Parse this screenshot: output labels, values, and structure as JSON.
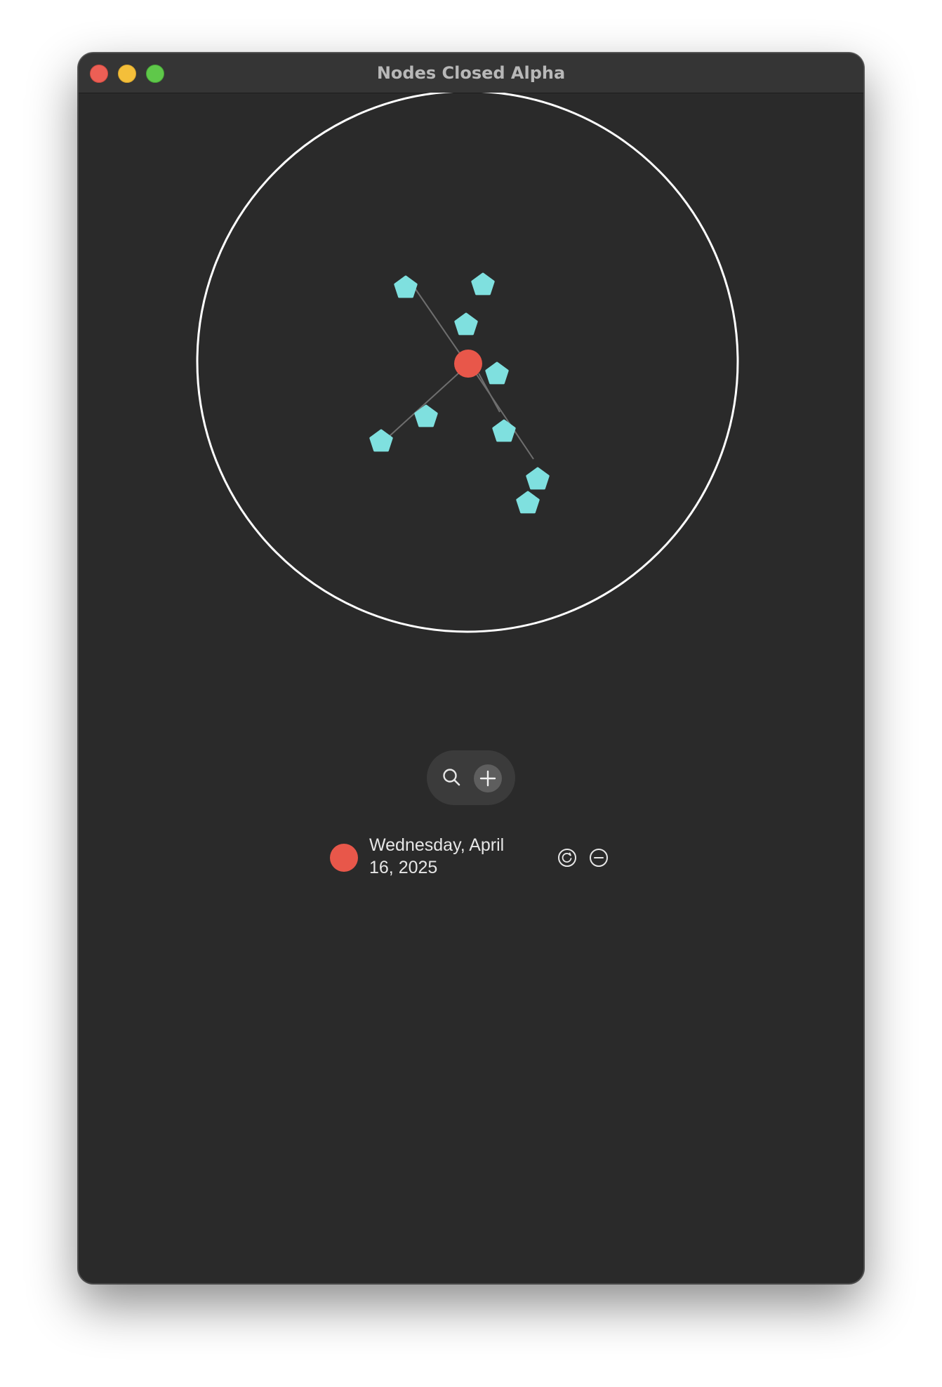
{
  "window": {
    "title": "Nodes Closed Alpha"
  },
  "graph": {
    "boundary_color": "#ffffff",
    "center_node_color": "#e8574a",
    "child_node_color": "#7fe0df",
    "edge_color": "#6e6e6e",
    "child_node_count": 10,
    "connected_child_count": 3
  },
  "toolbar": {
    "search_icon": "search-icon",
    "add_icon": "plus-icon"
  },
  "entries": [
    {
      "date": "Wednesday, April 16, 2025",
      "color": "#e8574a",
      "actions": [
        "refresh-icon",
        "minus-circle-icon"
      ]
    }
  ]
}
